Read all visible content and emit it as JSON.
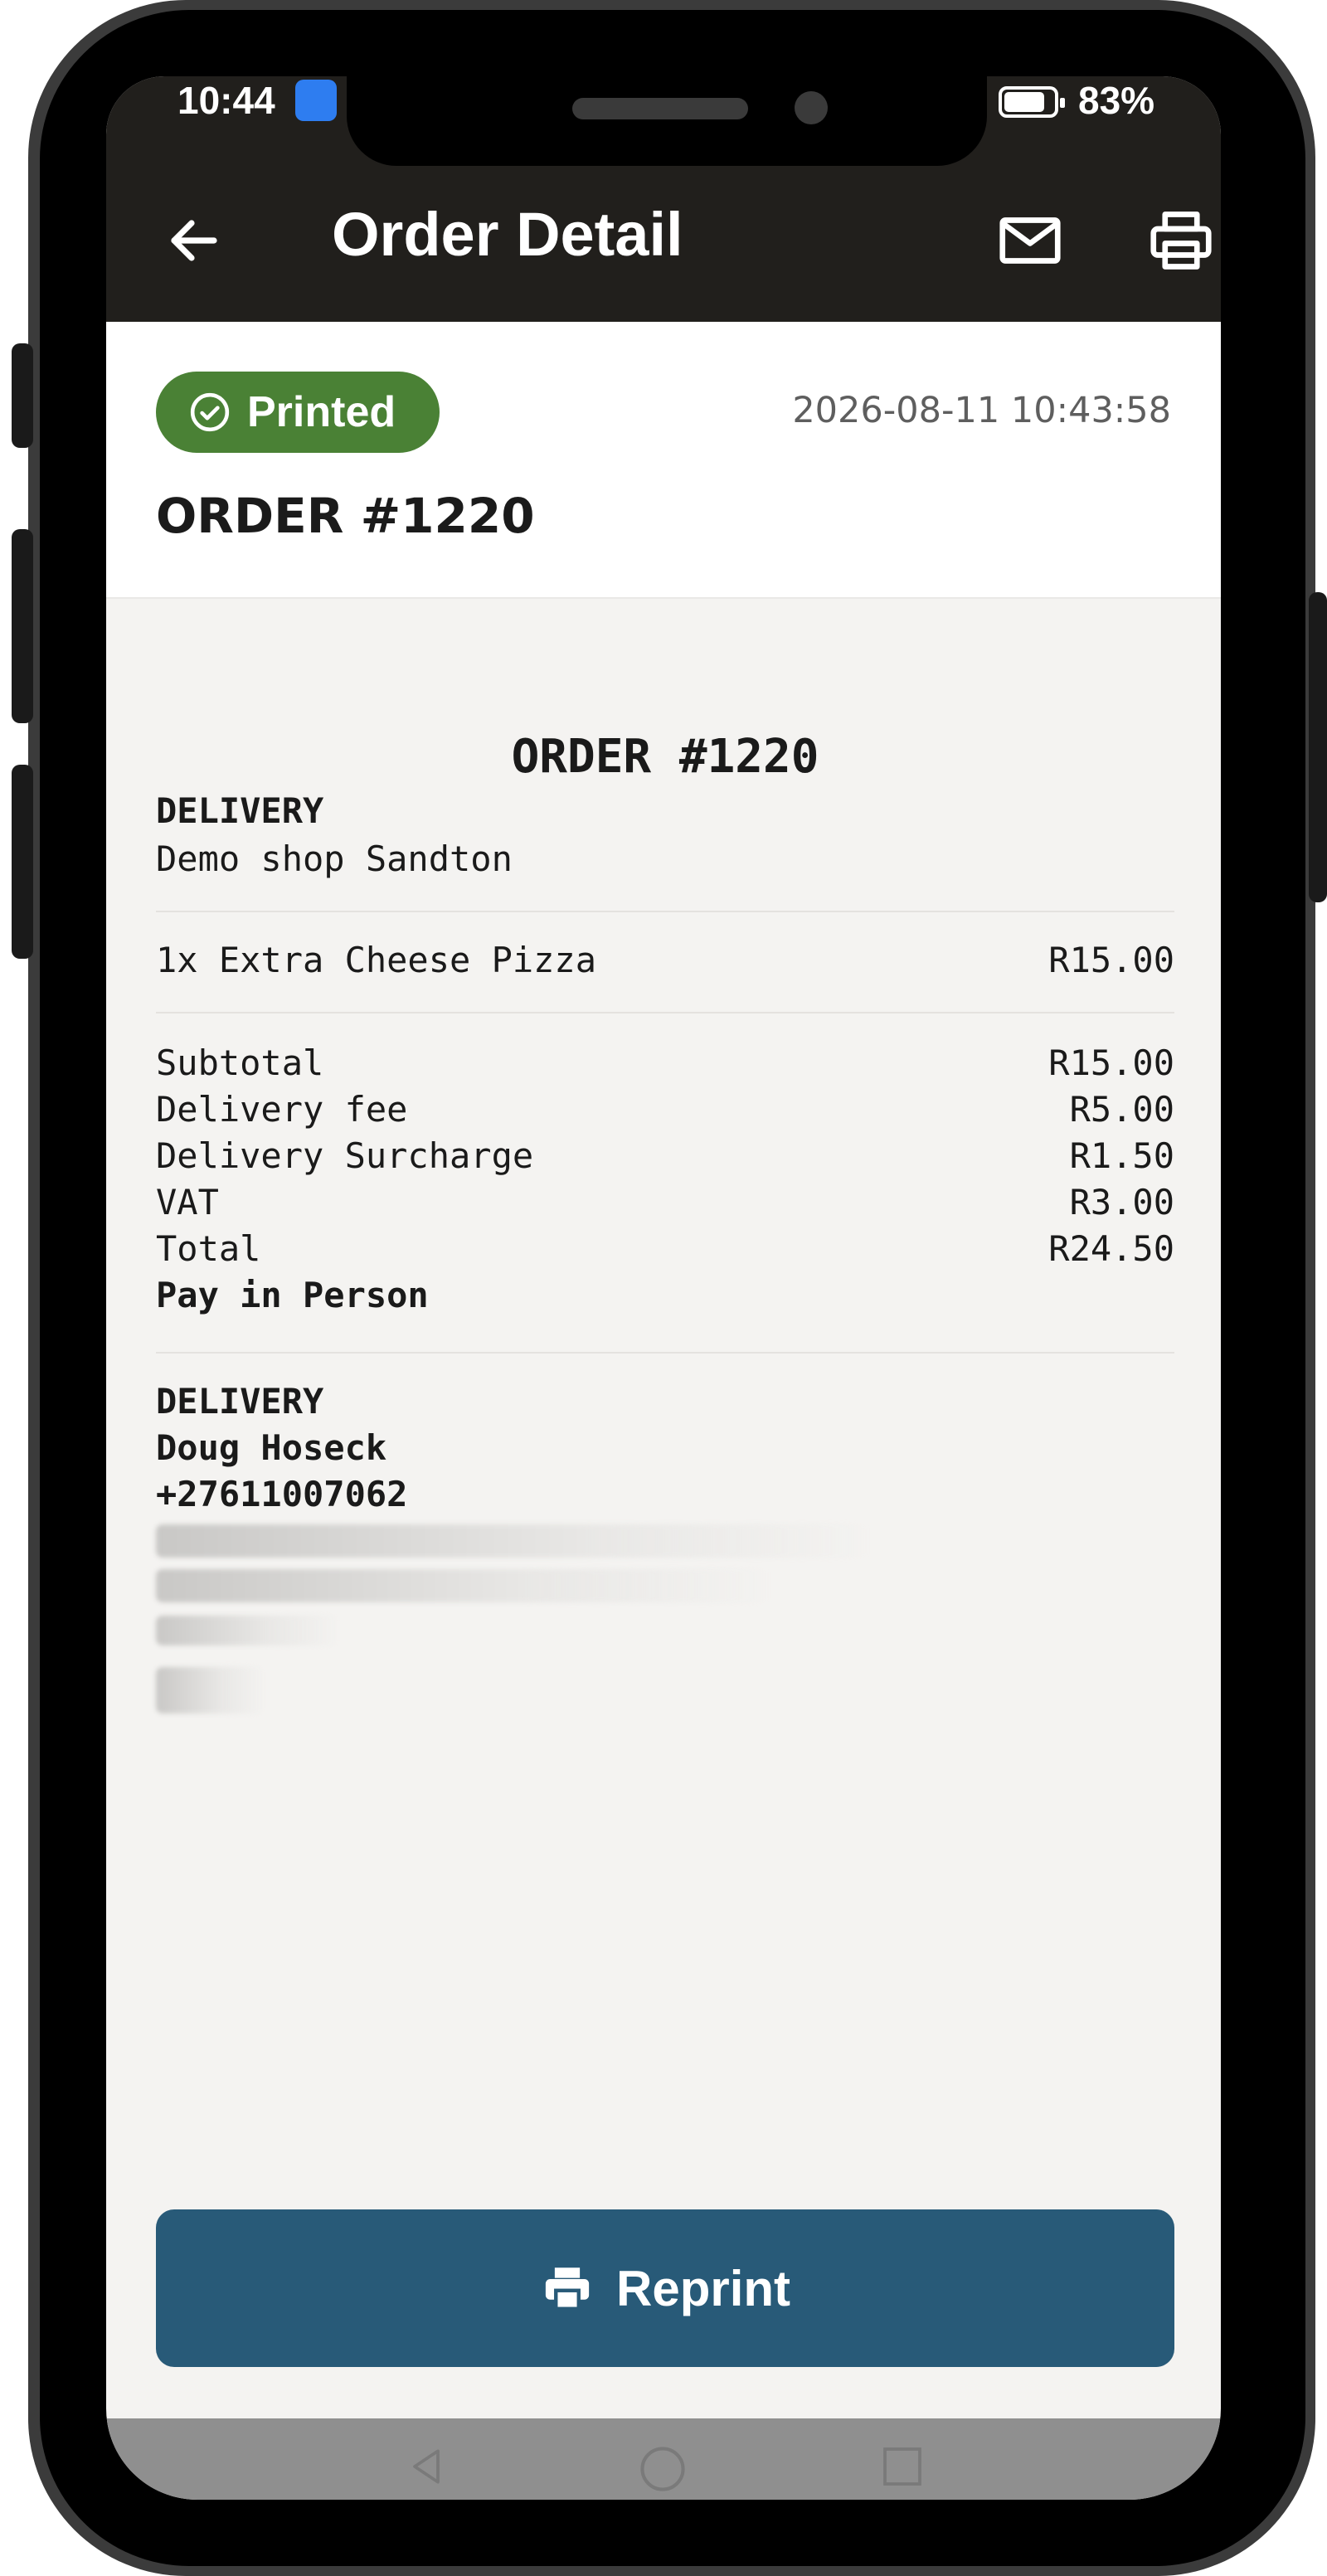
{
  "status_bar": {
    "time": "10:44",
    "battery": "83%",
    "battery_level": 0.83
  },
  "app_bar": {
    "title": "Order Detail",
    "back_icon": "arrow-left-icon",
    "email_icon": "mail-icon",
    "print_icon": "printer-icon"
  },
  "header": {
    "status_badge": "Printed",
    "status_color": "#4a8135",
    "timestamp": "2026-08-11 10:43:58",
    "order_number": "ORDER #1220"
  },
  "receipt": {
    "title": "ORDER #1220",
    "type": "DELIVERY",
    "shop": "Demo shop Sandton",
    "items": [
      {
        "label": "1x Extra Cheese Pizza",
        "amount": "R15.00"
      }
    ],
    "totals": [
      {
        "label": "Subtotal",
        "amount": "R15.00"
      },
      {
        "label": "Delivery fee",
        "amount": "R5.00"
      },
      {
        "label": "Delivery Surcharge",
        "amount": "R1.50"
      },
      {
        "label": "VAT",
        "amount": "R3.00"
      },
      {
        "label": "Total",
        "amount": "R24.50"
      }
    ],
    "payment": "Pay in Person",
    "customer": {
      "type": "DELIVERY",
      "name": "Doug Hoseck",
      "phone": "+27611007062"
    }
  },
  "actions": {
    "reprint_label": "Reprint",
    "reprint_color": "#285a78"
  },
  "nav": {
    "back": "triangle-back-icon",
    "home": "circle-home-icon",
    "recents": "square-recents-icon"
  }
}
